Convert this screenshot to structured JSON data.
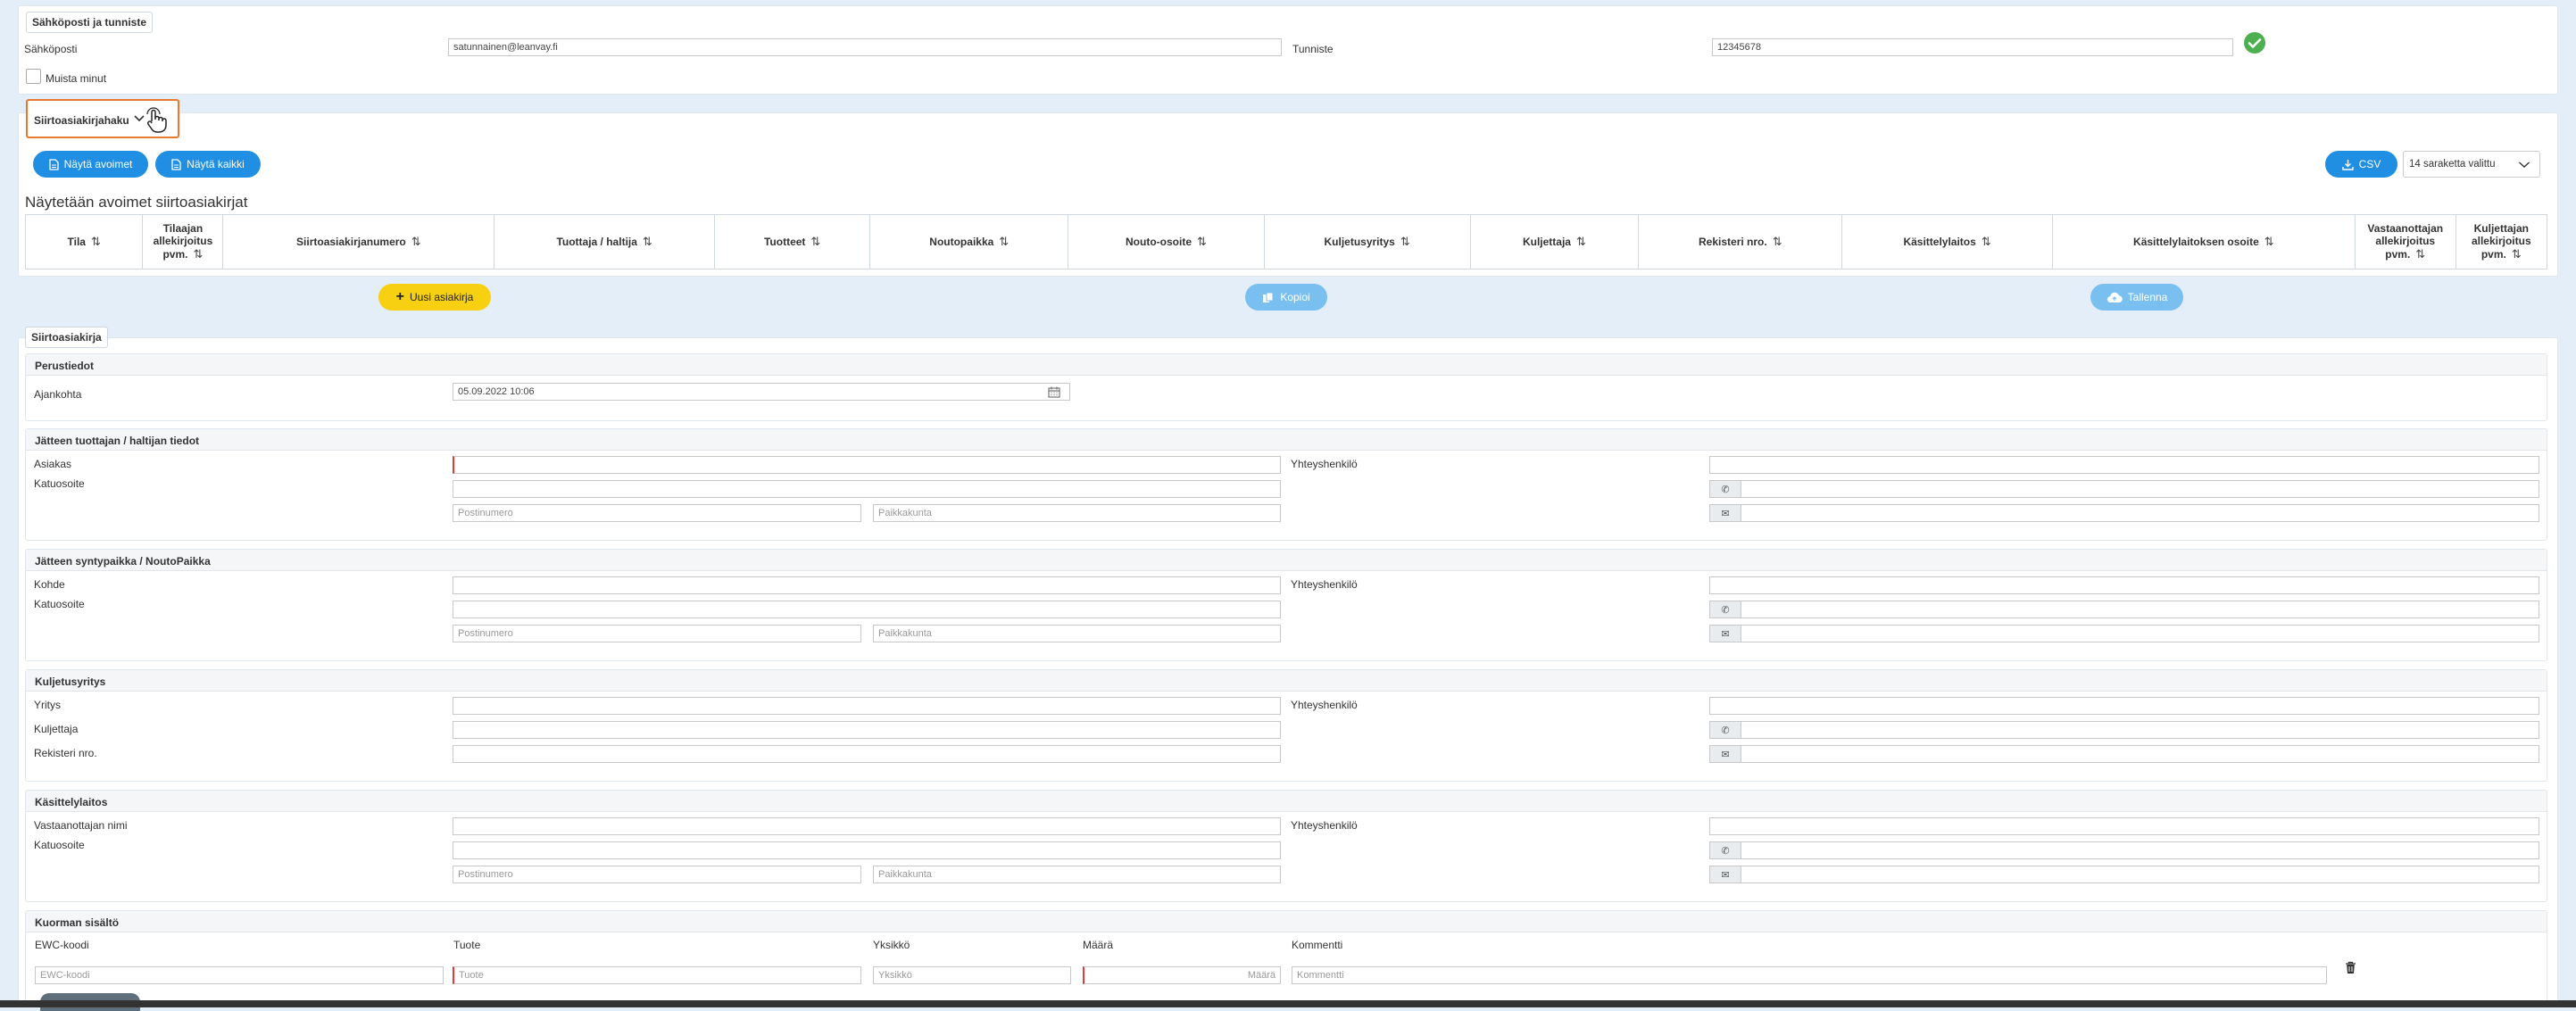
{
  "account": {
    "legend": "Sähköposti ja tunniste",
    "email_label": "Sähköposti",
    "email_value": "satunnainen@leanvay.fi",
    "id_label": "Tunniste",
    "id_value": "12345678",
    "remember_label": "Muista minut"
  },
  "search": {
    "legend": "Siirtoasiakirjahaku",
    "show_open": "Näytä avoimet",
    "show_all": "Näytä kaikki",
    "csv": "CSV",
    "columns_select": "14 saraketta valittu",
    "heading": "Näytetään avoimet siirtoasiakirjat",
    "columns": [
      "Tila",
      "Tilaajan allekirjoitus pvm.",
      "Siirtoasiakirjanumero",
      "Tuottaja / haltija",
      "Tuotteet",
      "Noutopaikka",
      "Nouto-osoite",
      "Kuljetusyritys",
      "Kuljettaja",
      "Rekisteri nro.",
      "Käsittelylaitos",
      "Käsittelylaitoksen osoite",
      "Vastaanottajan allekirjoitus pvm.",
      "Kuljettajan allekirjoitus pvm."
    ]
  },
  "actions": {
    "new_doc": "Uusi asiakirja",
    "copy": "Kopioi",
    "save": "Tallenna"
  },
  "doc": {
    "legend": "Siirtoasiakirja",
    "basic": {
      "title": "Perustiedot",
      "time_label": "Ajankohta",
      "time_value": "05.09.2022 10:06"
    },
    "producer": {
      "title": "Jätteen tuottajan / haltijan tiedot",
      "customer_label": "Asiakas",
      "street_label": "Katuosoite",
      "contact_label": "Yhteyshenkilö",
      "postal_ph": "Postinumero",
      "city_ph": "Paikkakunta"
    },
    "origin": {
      "title": "Jätteen syntypaikka / NoutoPaikka",
      "site_label": "Kohde",
      "street_label": "Katuosoite",
      "contact_label": "Yhteyshenkilö",
      "postal_ph": "Postinumero",
      "city_ph": "Paikkakunta"
    },
    "carrier": {
      "title": "Kuljetusyritys",
      "company_label": "Yritys",
      "driver_label": "Kuljettaja",
      "reg_label": "Rekisteri nro.",
      "contact_label": "Yhteyshenkilö"
    },
    "facility": {
      "title": "Käsittelylaitos",
      "receiver_label": "Vastaanottajan nimi",
      "street_label": "Katuosoite",
      "contact_label": "Yhteyshenkilö",
      "postal_ph": "Postinumero",
      "city_ph": "Paikkakunta"
    },
    "load": {
      "title": "Kuorman sisältö",
      "ewc_label": "EWC-koodi",
      "product_label": "Tuote",
      "unit_label": "Yksikkö",
      "qty_label": "Määrä",
      "comment_label": "Kommentti",
      "ewc_ph": "EWC-koodi",
      "product_ph": "Tuote",
      "unit_ph": "Yksikkö",
      "qty_ph": "Määrä",
      "comment_ph": "Kommentti"
    }
  },
  "colors": {
    "primary": "#1f8ee3",
    "accent_yellow": "#f7d111",
    "success": "#4caf50",
    "required": "#e53935",
    "focus_outline": "#e8792e"
  }
}
